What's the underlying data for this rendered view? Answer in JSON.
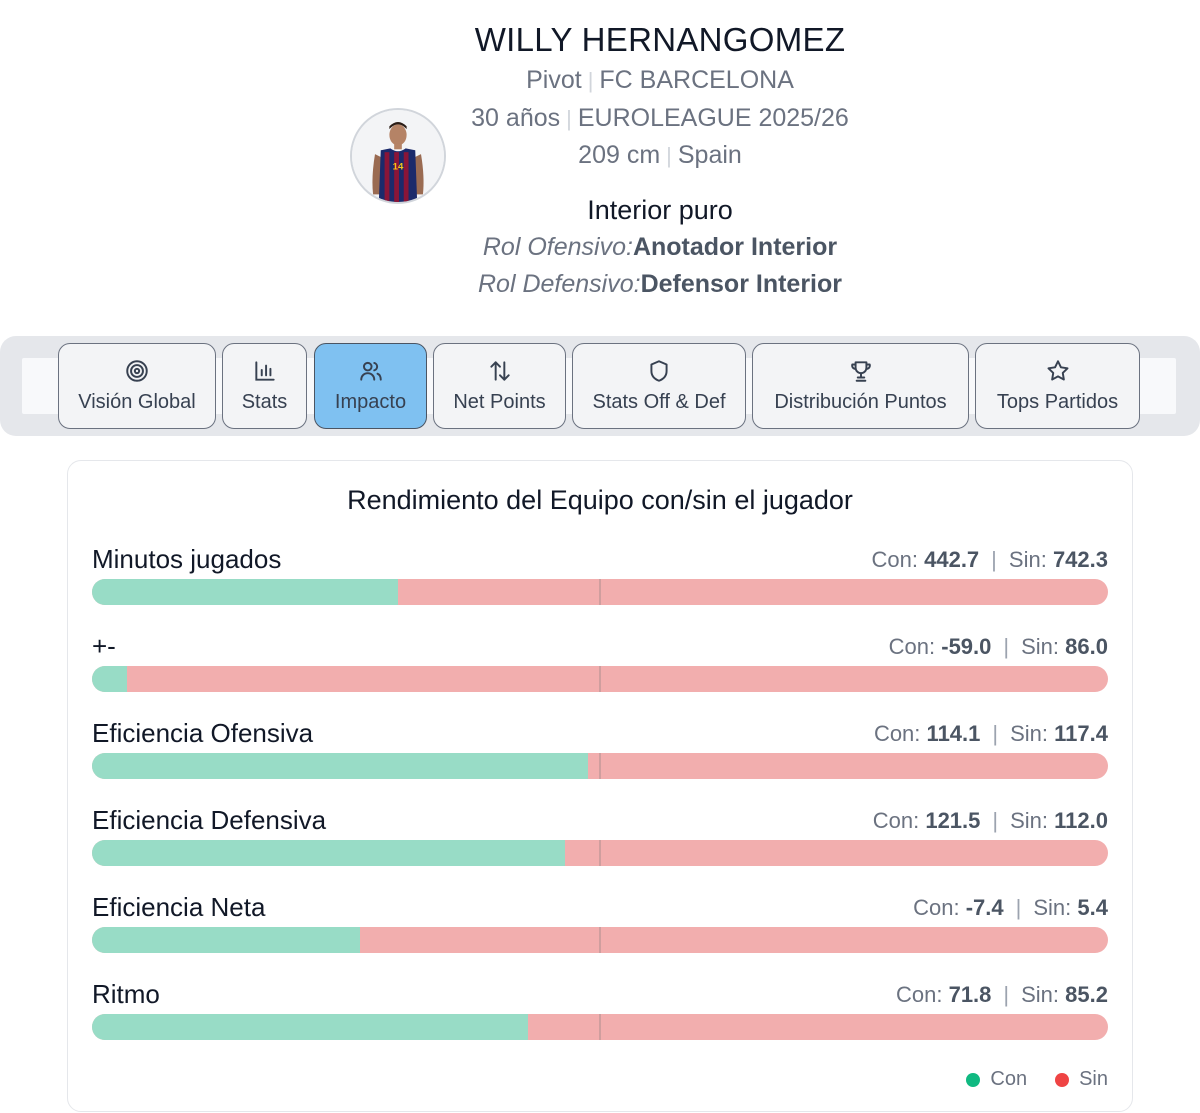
{
  "player": {
    "name": "WILLY HERNANGOMEZ",
    "position": "Pivot",
    "team": "FC BARCELONA",
    "age": "30 años",
    "competition": "EUROLEAGUE 2025/26",
    "height": "209 cm",
    "country": "Spain",
    "archetype": "Interior puro",
    "offensive_role_label": "Rol Ofensivo:",
    "offensive_role": "Anotador Interior",
    "defensive_role_label": "Rol Defensivo:",
    "defensive_role": "Defensor Interior",
    "jersey_number": "14"
  },
  "tabs": [
    {
      "label": "Visión Global",
      "icon": "target-icon",
      "active": false
    },
    {
      "label": "Stats",
      "icon": "bar-chart-icon",
      "active": false
    },
    {
      "label": "Impacto",
      "icon": "users-icon",
      "active": true
    },
    {
      "label": "Net Points",
      "icon": "arrows-up-down-icon",
      "active": false
    },
    {
      "label": "Stats Off & Def",
      "icon": "shield-icon",
      "active": false
    },
    {
      "label": "Distribución Puntos",
      "icon": "trophy-icon",
      "active": false
    },
    {
      "label": "Tops Partidos",
      "icon": "star-icon",
      "active": false
    }
  ],
  "impact": {
    "title": "Rendimiento del Equipo con/sin el jugador",
    "con_label": "Con:",
    "sin_label": "Sin:",
    "separator": "|",
    "metrics": [
      {
        "label": "Minutos jugados",
        "con": "442.7",
        "sin": "742.3",
        "con_share": 0.301
      },
      {
        "label": "+-",
        "con": "-59.0",
        "sin": "86.0",
        "con_share": 0.034
      },
      {
        "label": "Eficiencia Ofensiva",
        "con": "114.1",
        "sin": "117.4",
        "con_share": 0.488
      },
      {
        "label": "Eficiencia Defensiva",
        "con": "121.5",
        "sin": "112.0",
        "con_share": 0.466
      },
      {
        "label": "Eficiencia Neta",
        "con": "-7.4",
        "sin": "5.4",
        "con_share": 0.264
      },
      {
        "label": "Ritmo",
        "con": "71.8",
        "sin": "85.2",
        "con_share": 0.429
      }
    ],
    "legend": [
      {
        "label": "Con",
        "color": "#10b981"
      },
      {
        "label": "Sin",
        "color": "#ef4444"
      }
    ]
  },
  "colors": {
    "con_bar": "#98dcc6",
    "sin_bar": "#f2aeae",
    "active_tab": "#7fc1f1"
  }
}
